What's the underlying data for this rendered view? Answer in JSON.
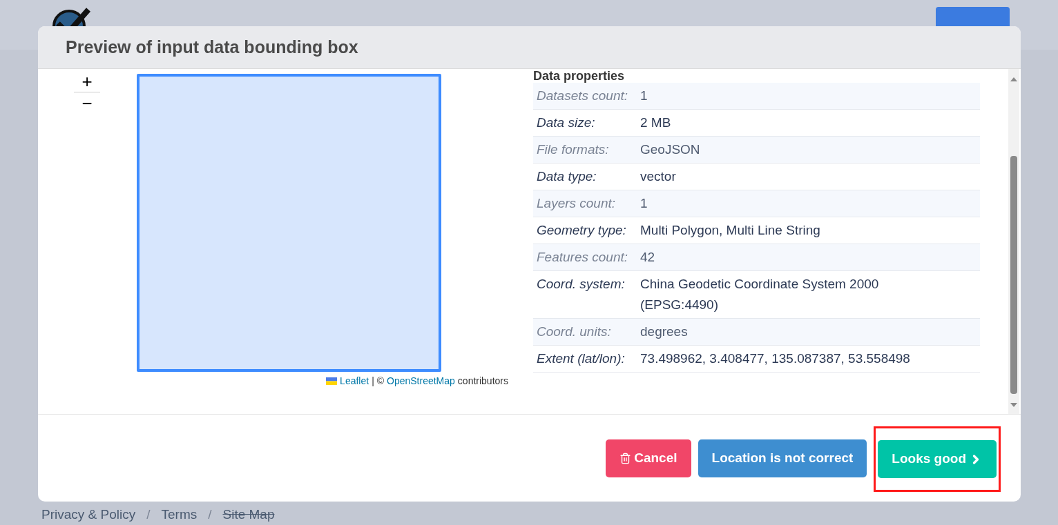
{
  "modal": {
    "title": "Preview of input data bounding box",
    "map": {
      "zoom_in": "+",
      "zoom_out": "−",
      "attribution": {
        "leaflet": "Leaflet",
        "separator": "| ©",
        "osm": "OpenStreetMap",
        "suffix": "contributors"
      }
    },
    "properties": {
      "heading": "Data properties",
      "rows": [
        {
          "label": "Datasets count:",
          "value": "1"
        },
        {
          "label": "Data size:",
          "value": "2 MB"
        },
        {
          "label": "File formats:",
          "value": "GeoJSON"
        },
        {
          "label": "Data type:",
          "value": "vector"
        },
        {
          "label": "Layers count:",
          "value": "1"
        },
        {
          "label": "Geometry type:",
          "value": "Multi Polygon, Multi Line String"
        },
        {
          "label": "Features count:",
          "value": "42"
        },
        {
          "label": "Coord. system:",
          "value": "China Geodetic Coordinate System 2000 (EPSG:4490)"
        },
        {
          "label": "Coord. units:",
          "value": "degrees"
        },
        {
          "label": "Extent (lat/lon):",
          "value": "73.498962, 3.408477, 135.087387, 53.558498"
        }
      ]
    },
    "buttons": [
      {
        "kind": "cancel",
        "label": "Cancel",
        "highlighted": false
      },
      {
        "kind": "secondary",
        "label": "Location is not correct",
        "highlighted": false
      },
      {
        "kind": "confirm",
        "label": "Looks good",
        "highlighted": true
      }
    ]
  },
  "footer": {
    "separator": "/",
    "links": [
      "Privacy & Policy",
      "Terms",
      "Site Map"
    ]
  }
}
